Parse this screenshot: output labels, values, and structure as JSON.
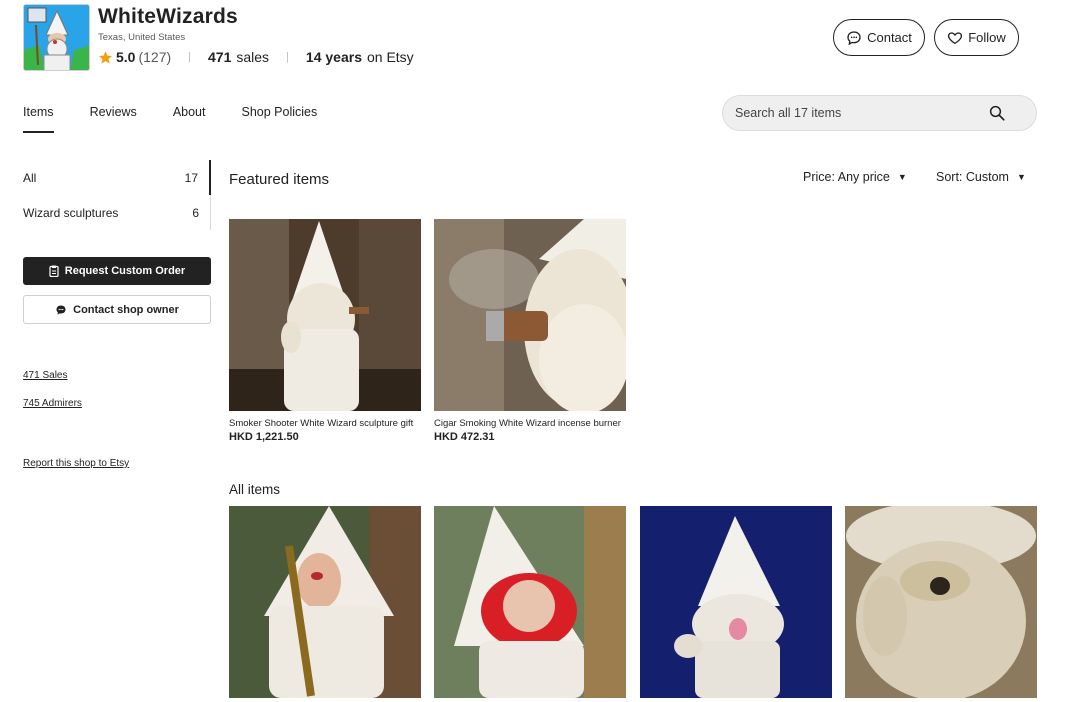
{
  "shop": {
    "name": "WhiteWizards",
    "location": "Texas, United States",
    "rating": "5.0",
    "review_count": "(127)",
    "sales_count": "471",
    "sales_label": "sales",
    "years_bold": "14 years",
    "years_rest": "on Etsy",
    "separator": "|"
  },
  "actions": {
    "contact_label": "Contact",
    "follow_label": "Follow"
  },
  "tabs": [
    {
      "label": "Items",
      "active": true
    },
    {
      "label": "Reviews"
    },
    {
      "label": "About"
    },
    {
      "label": "Shop Policies"
    }
  ],
  "search": {
    "placeholder": "Search all 17 items"
  },
  "sidebar": {
    "sections": [
      {
        "label": "All",
        "count": "17",
        "active": true
      },
      {
        "label": "Wizard sculptures",
        "count": "6"
      }
    ],
    "request_custom_label": "Request Custom Order",
    "contact_owner_label": "Contact shop owner",
    "sales_link": "471 Sales",
    "admirers_link": "745 Admirers",
    "report_link": "Report this shop to Etsy"
  },
  "featured": {
    "title": "Featured items",
    "price_filter": "Price: Any price",
    "sort_filter": "Sort: Custom",
    "items": [
      {
        "title": "Smoker Shooter White Wizard sculpture gift",
        "price": "HKD 1,221.50"
      },
      {
        "title": "Cigar Smoking White Wizard incense burner",
        "price": "HKD 472.31"
      }
    ]
  },
  "all_items": {
    "title": "All items"
  },
  "colors": {
    "text": "#222222",
    "muted": "#595959",
    "star": "#f1a10d",
    "dark_button": "#222222",
    "search_bg": "#efefef"
  }
}
